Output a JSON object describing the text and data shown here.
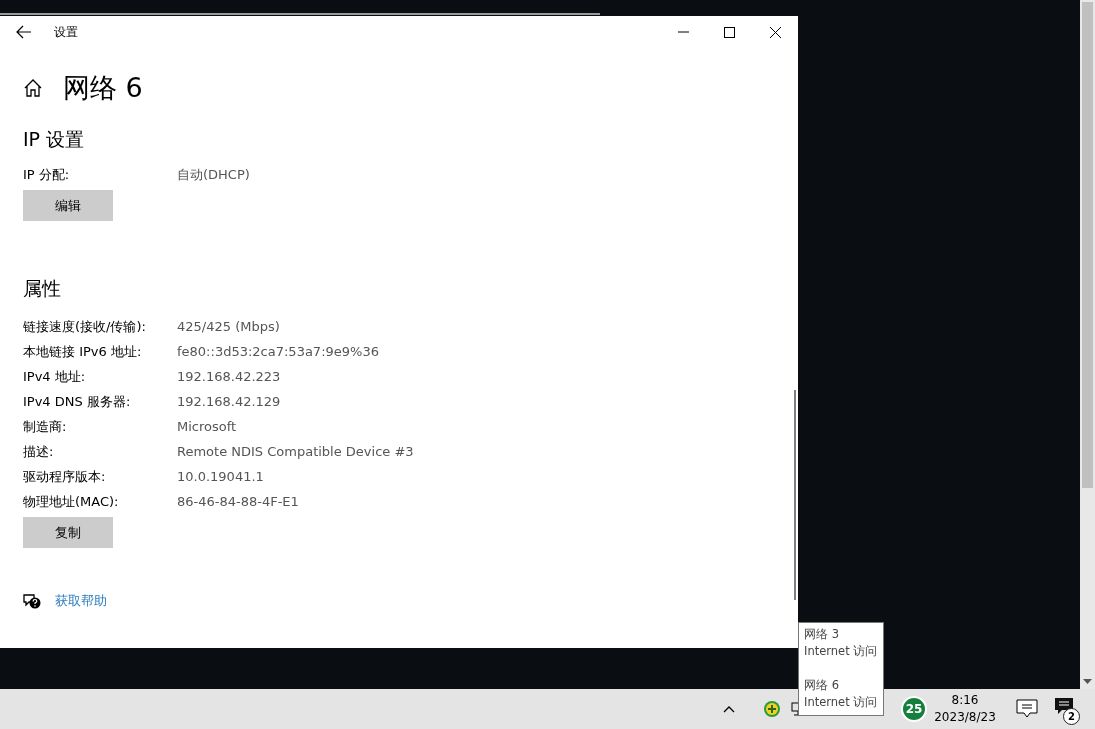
{
  "window": {
    "title": "设置",
    "page_title": "网络 6"
  },
  "ip_settings": {
    "heading": "IP 设置",
    "rows": [
      {
        "label": "IP 分配:",
        "value": "自动(DHCP)"
      }
    ],
    "button": "编辑"
  },
  "properties": {
    "heading": "属性",
    "rows": [
      {
        "label": "链接速度(接收/传输):",
        "value": "425/425 (Mbps)"
      },
      {
        "label": "本地链接 IPv6 地址:",
        "value": "fe80::3d53:2ca7:53a7:9e9%36"
      },
      {
        "label": "IPv4 地址:",
        "value": "192.168.42.223"
      },
      {
        "label": "IPv4 DNS 服务器:",
        "value": "192.168.42.129"
      },
      {
        "label": "制造商:",
        "value": "Microsoft"
      },
      {
        "label": "描述:",
        "value": "Remote NDIS Compatible Device #3"
      },
      {
        "label": "驱动程序版本:",
        "value": "10.0.19041.1"
      },
      {
        "label": "物理地址(MAC):",
        "value": "86-46-84-88-4F-E1"
      }
    ],
    "button": "复制"
  },
  "help_link": "获取帮助",
  "tooltip": {
    "entries": [
      {
        "name": "网络 3",
        "status": "Internet 访问"
      },
      {
        "name": "网络 6",
        "status": "Internet 访问"
      }
    ]
  },
  "taskbar": {
    "badge_count": "25",
    "time": "8:16",
    "date": "2023/8/23",
    "notification_count": "2"
  }
}
